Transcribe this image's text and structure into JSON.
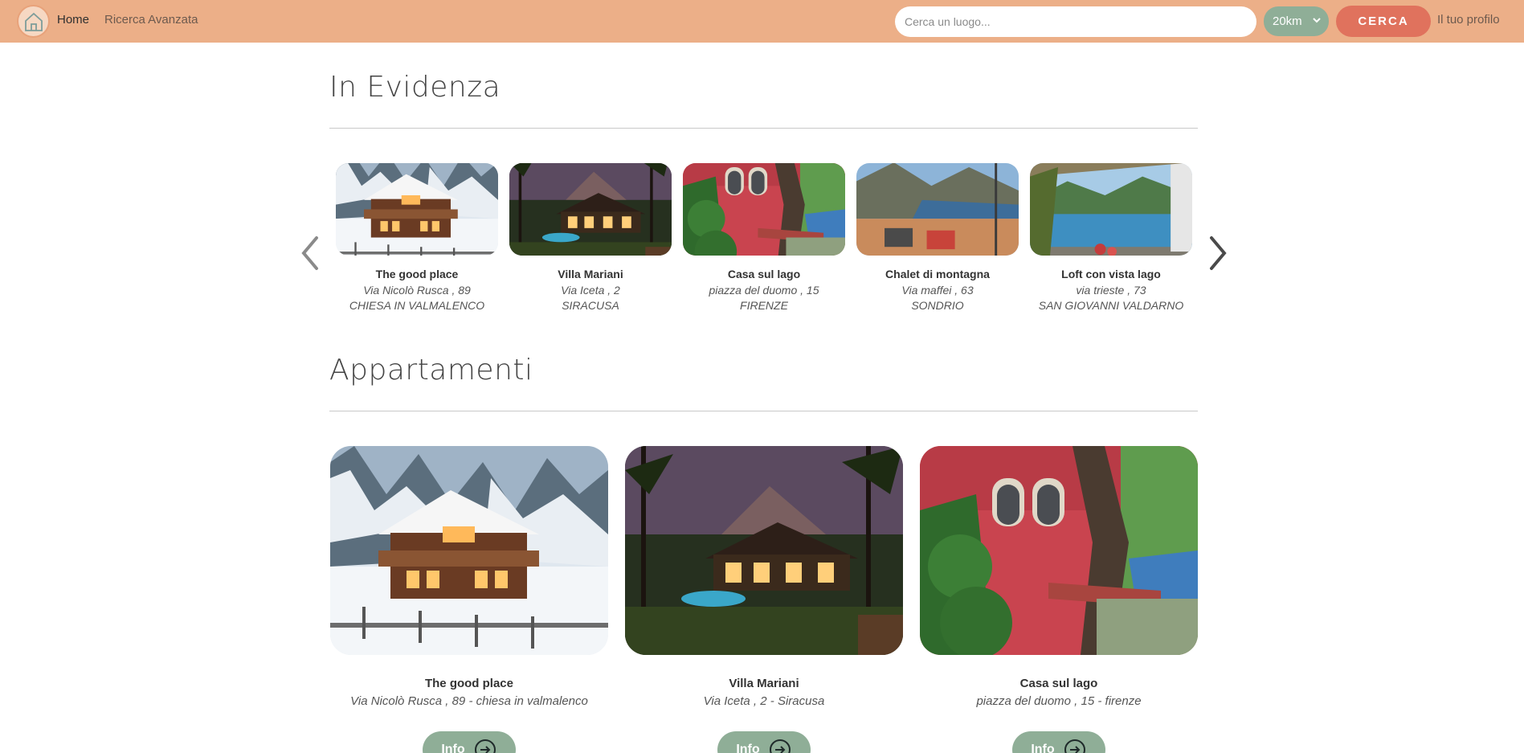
{
  "navbar": {
    "home_label": "Home",
    "advanced_search_label": "Ricerca Avanzata",
    "search_placeholder": "Cerca un luogo...",
    "distance_value": "20km",
    "search_button_label": "CERCA",
    "profile_label": "Il tuo profilo",
    "logo_icon": "house-icon"
  },
  "featured": {
    "title": "In Evidenza",
    "items": [
      {
        "name": "The good place",
        "address": "Via Nicolò Rusca , 89",
        "city": "CHIESA IN VALMALENCO"
      },
      {
        "name": "Villa Mariani",
        "address": "Via Iceta , 2",
        "city": "SIRACUSA"
      },
      {
        "name": "Casa sul lago",
        "address": "piazza del duomo , 15",
        "city": "FIRENZE"
      },
      {
        "name": "Chalet di montagna",
        "address": "Via maffei , 63",
        "city": "SONDRIO"
      },
      {
        "name": "Loft con vista lago",
        "address": "via trieste , 73",
        "city": "SAN GIOVANNI VALDARNO"
      }
    ]
  },
  "apartments": {
    "title": "Appartamenti",
    "items": [
      {
        "name": "The good place",
        "address": "Via Nicolò Rusca , 89 - chiesa in valmalenco",
        "button": "Info"
      },
      {
        "name": "Villa Mariani",
        "address": "Via Iceta , 2 - Siracusa",
        "button": "Info"
      },
      {
        "name": "Casa sul lago",
        "address": "piazza del duomo , 15 - firenze",
        "button": "Info"
      }
    ]
  },
  "colors": {
    "navbar_bg": "#ecaf88",
    "accent_green": "#8fae97",
    "accent_red": "#e0725d"
  }
}
